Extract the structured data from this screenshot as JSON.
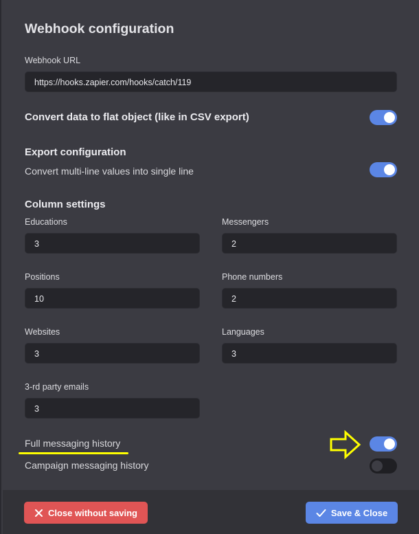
{
  "dialog": {
    "title": "Webhook configuration"
  },
  "webhook": {
    "label": "Webhook URL",
    "value": "https://hooks.zapier.com/hooks/catch/119"
  },
  "flat_object": {
    "label": "Convert data to flat object (like in CSV export)",
    "enabled": true
  },
  "export": {
    "title": "Export configuration",
    "multiline_label": "Convert multi-line values into single line",
    "multiline_enabled": true
  },
  "columns": {
    "title": "Column settings",
    "fields": [
      {
        "label": "Educations",
        "value": "3"
      },
      {
        "label": "Messengers",
        "value": "2"
      },
      {
        "label": "Positions",
        "value": "10"
      },
      {
        "label": "Phone numbers",
        "value": "2"
      },
      {
        "label": "Websites",
        "value": "3"
      },
      {
        "label": "Languages",
        "value": "3"
      },
      {
        "label": "3-rd party emails",
        "value": "3"
      }
    ]
  },
  "history": {
    "full_label": "Full messaging history",
    "full_enabled": true,
    "campaign_label": "Campaign messaging history",
    "campaign_enabled": false
  },
  "footer": {
    "close_label": "Close without saving",
    "save_label": "Save & Close"
  },
  "colors": {
    "accent": "#5b86e5",
    "danger": "#e05555",
    "annotation": "#ffff00"
  }
}
